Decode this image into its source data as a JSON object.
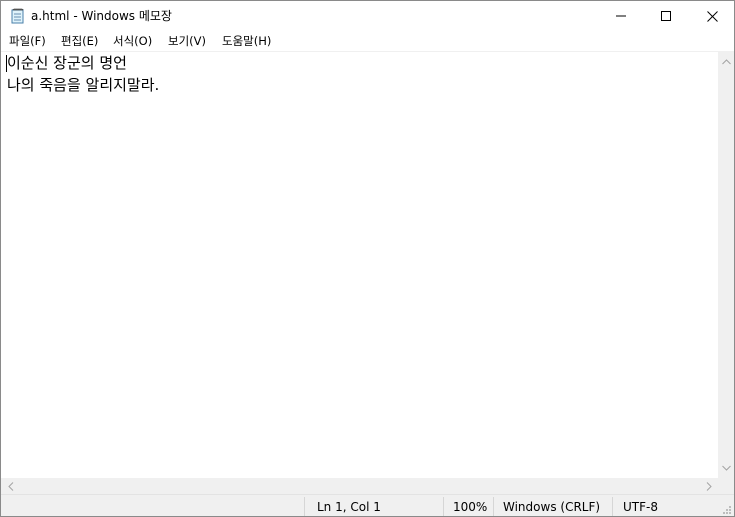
{
  "window": {
    "title": "a.html - Windows 메모장",
    "icon": "notepad-icon"
  },
  "menu": {
    "items": [
      {
        "label": "파일(F)"
      },
      {
        "label": "편집(E)"
      },
      {
        "label": "서식(O)"
      },
      {
        "label": "보기(V)"
      },
      {
        "label": "도움말(H)"
      }
    ]
  },
  "editor": {
    "lines": [
      "이순신 장군의 명언",
      "나의 죽음을 알리지말라."
    ]
  },
  "statusbar": {
    "position": "Ln 1, Col 1",
    "zoom": "100%",
    "line_ending": "Windows (CRLF)",
    "encoding": "UTF-8"
  }
}
